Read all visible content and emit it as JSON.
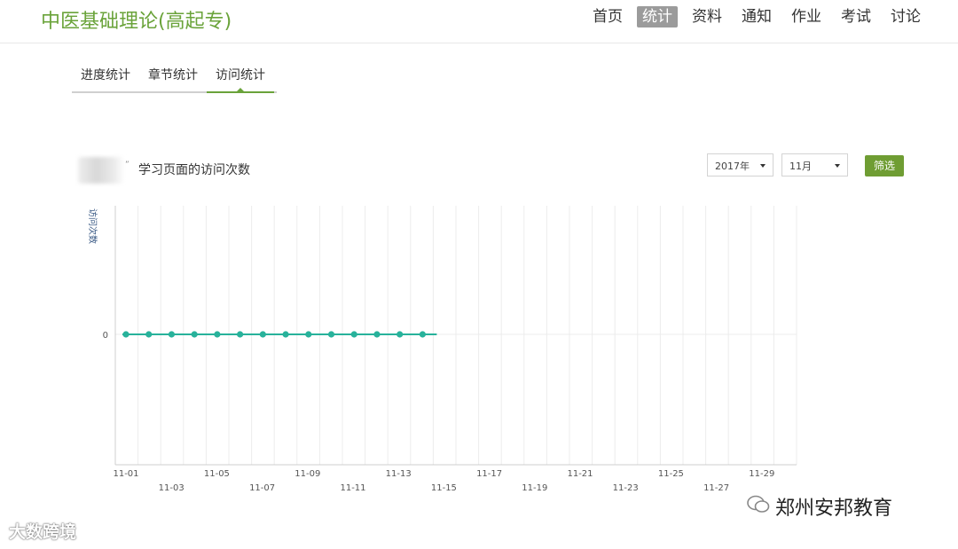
{
  "header": {
    "course_title": "中医基础理论(高起专)",
    "nav": [
      "首页",
      "统计",
      "资料",
      "通知",
      "作业",
      "考试",
      "讨论"
    ],
    "active_nav": "统计"
  },
  "subtabs": {
    "items": [
      "进度统计",
      "章节统计",
      "访问统计"
    ],
    "active": "访问统计"
  },
  "chart_header": {
    "quote": "”",
    "title": "学习页面的访问次数"
  },
  "filters": {
    "year": "2017年",
    "month": "11月",
    "button": "筛选"
  },
  "chart_data": {
    "type": "line",
    "ylabel": "访问次数",
    "y_ticks": [
      "0"
    ],
    "x_tick_labels": [
      "11-01",
      "11-03",
      "11-05",
      "11-07",
      "11-09",
      "11-11",
      "11-13",
      "11-15",
      "11-17",
      "11-19",
      "11-21",
      "11-23",
      "11-25",
      "11-27",
      "11-29"
    ],
    "x": [
      "11-01",
      "11-02",
      "11-03",
      "11-04",
      "11-05",
      "11-06",
      "11-07",
      "11-08",
      "11-09",
      "11-10",
      "11-11",
      "11-12",
      "11-13",
      "11-14"
    ],
    "series": [
      {
        "values": [
          0,
          0,
          0,
          0,
          0,
          0,
          0,
          0,
          0,
          0,
          0,
          0,
          0,
          0
        ],
        "color": "#28b29b"
      }
    ],
    "x_days": 30,
    "grid": true
  },
  "watermarks": {
    "left": "大数跨境",
    "right": "郑州安邦教育",
    "right_icon": "wechat-icon"
  }
}
